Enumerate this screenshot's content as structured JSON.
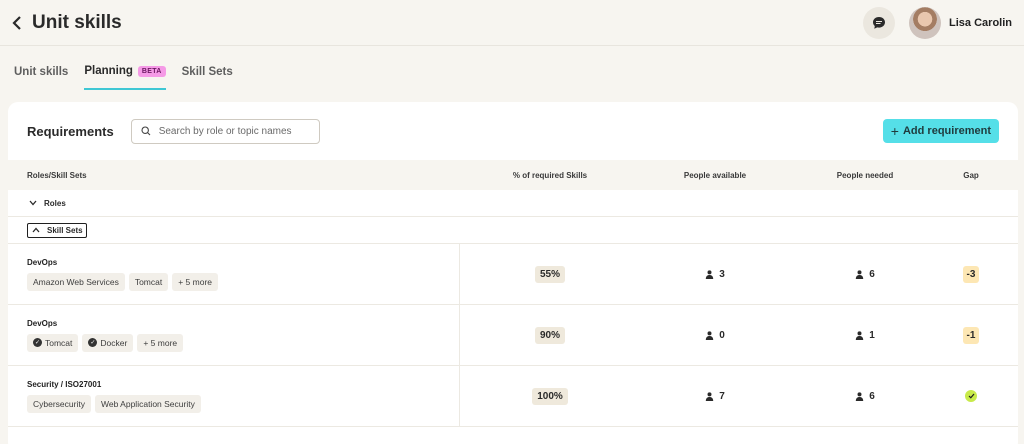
{
  "header": {
    "title": "Unit skills",
    "user_name": "Lisa Carolin"
  },
  "tabs": [
    {
      "label": "Unit skills",
      "active": false
    },
    {
      "label": "Planning",
      "active": true,
      "badge": "BETA"
    },
    {
      "label": "Skill Sets",
      "active": false
    }
  ],
  "requirements": {
    "title": "Requirements",
    "search_placeholder": "Search by role or topic names",
    "add_label": "Add requirement"
  },
  "table": {
    "columns": [
      "Roles/Skill Sets",
      "% of required Skills",
      "People available",
      "People needed",
      "Gap"
    ],
    "groups": [
      {
        "label": "Roles",
        "expanded": false
      },
      {
        "label": "Skill Sets",
        "expanded": true
      }
    ],
    "rows": [
      {
        "name": "DevOps",
        "chips": [
          {
            "label": "Amazon Web Services",
            "checked": false
          },
          {
            "label": "Tomcat",
            "checked": false
          },
          {
            "label": "+ 5 more",
            "checked": false
          }
        ],
        "pct": "55%",
        "available": "3",
        "needed": "6",
        "gap": "-3"
      },
      {
        "name": "DevOps",
        "chips": [
          {
            "label": "Tomcat",
            "checked": true
          },
          {
            "label": "Docker",
            "checked": true
          },
          {
            "label": "+ 5 more",
            "checked": false
          }
        ],
        "pct": "90%",
        "available": "0",
        "needed": "1",
        "gap": "-1"
      },
      {
        "name": "Security / ISO27001",
        "chips": [
          {
            "label": "Cybersecurity",
            "checked": false
          },
          {
            "label": "Web Application Security",
            "checked": false
          }
        ],
        "pct": "100%",
        "available": "7",
        "needed": "6",
        "gap": ""
      }
    ]
  },
  "colors": {
    "accent": "#55dfe8",
    "tab_underline": "#3fc7d4",
    "beta": "#f59ae6",
    "gap_warning": "#fde7b4",
    "gap_ok": "#c8ea4a"
  }
}
